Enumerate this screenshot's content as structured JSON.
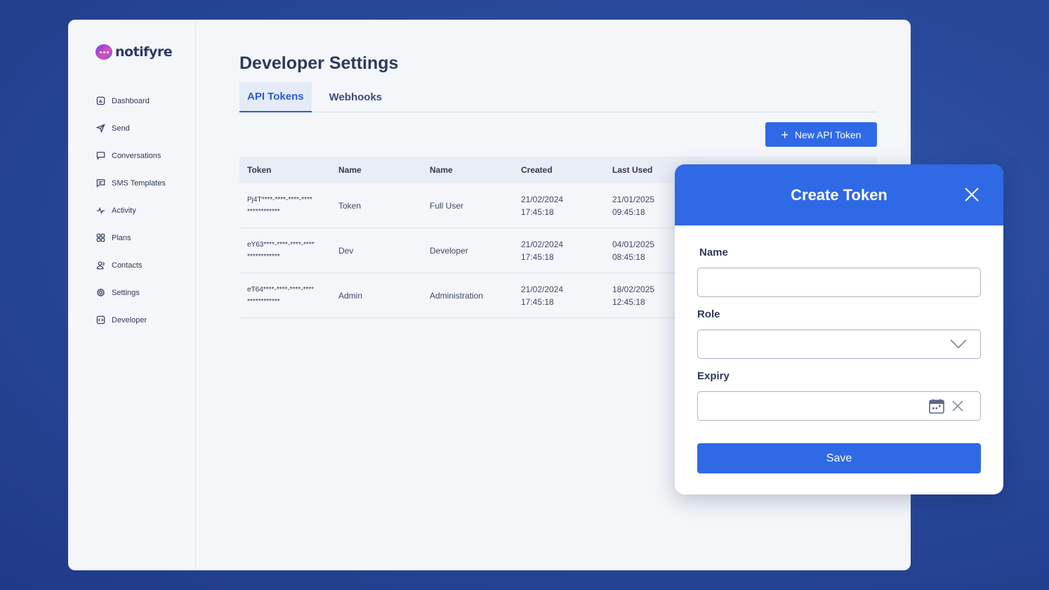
{
  "brand": {
    "name": "notifyre"
  },
  "sidebar": {
    "items": [
      {
        "label": "Dashboard",
        "icon": "dashboard-icon"
      },
      {
        "label": "Send",
        "icon": "send-icon"
      },
      {
        "label": "Conversations",
        "icon": "chat-icon"
      },
      {
        "label": "SMS Templates",
        "icon": "template-icon"
      },
      {
        "label": "Activity",
        "icon": "activity-icon"
      },
      {
        "label": "Plans",
        "icon": "grid-icon"
      },
      {
        "label": "Contacts",
        "icon": "contacts-icon"
      },
      {
        "label": "Settings",
        "icon": "gear-icon"
      },
      {
        "label": "Developer",
        "icon": "code-icon"
      }
    ]
  },
  "page": {
    "title": "Developer Settings"
  },
  "tabs": [
    {
      "label": "API Tokens",
      "active": true
    },
    {
      "label": "Webhooks",
      "active": false
    }
  ],
  "toolbar": {
    "new_token_label": "New API Token"
  },
  "table": {
    "columns": [
      "Token",
      "Name",
      "Name",
      "Created",
      "Last Used"
    ],
    "rows": [
      {
        "token_line1": "Pj4T****-****-****-****",
        "token_line2": "************",
        "name": "Token",
        "role": "Full User",
        "created_date": "21/02/2024",
        "created_time": "17:45:18",
        "last_used_date": "21/01/2025",
        "last_used_time": "09:45:18"
      },
      {
        "token_line1": "eY63****-****-****-****",
        "token_line2": "************",
        "name": "Dev",
        "role": "Developer",
        "created_date": "21/02/2024",
        "created_time": "17:45:18",
        "last_used_date": "04/01/2025",
        "last_used_time": "08:45:18"
      },
      {
        "token_line1": "eT64****-****-****-****",
        "token_line2": "************",
        "name": "Admin",
        "role": "Administration",
        "created_date": "21/02/2024",
        "created_time": "17:45:18",
        "last_used_date": "18/02/2025",
        "last_used_time": "12:45:18"
      }
    ]
  },
  "modal": {
    "title": "Create Token",
    "name_label": "Name",
    "name_value": "",
    "role_label": "Role",
    "role_value": "",
    "expiry_label": "Expiry",
    "expiry_value": "",
    "save_label": "Save"
  },
  "colors": {
    "accent": "#2f69e6",
    "background": "#24449a",
    "panel": "#f4f6fa"
  }
}
